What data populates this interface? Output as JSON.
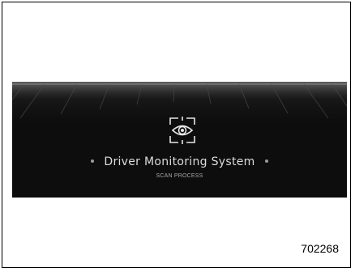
{
  "screen": {
    "icon": "eye-scan-icon",
    "title": "Driver Monitoring System",
    "subtitle": "SCAN PROCESS"
  },
  "figure": {
    "code": "702268"
  },
  "colors": {
    "screen_background": "#0d0d0d",
    "title_text": "#dcdcdc",
    "subtitle_text": "#a8a8a8"
  }
}
